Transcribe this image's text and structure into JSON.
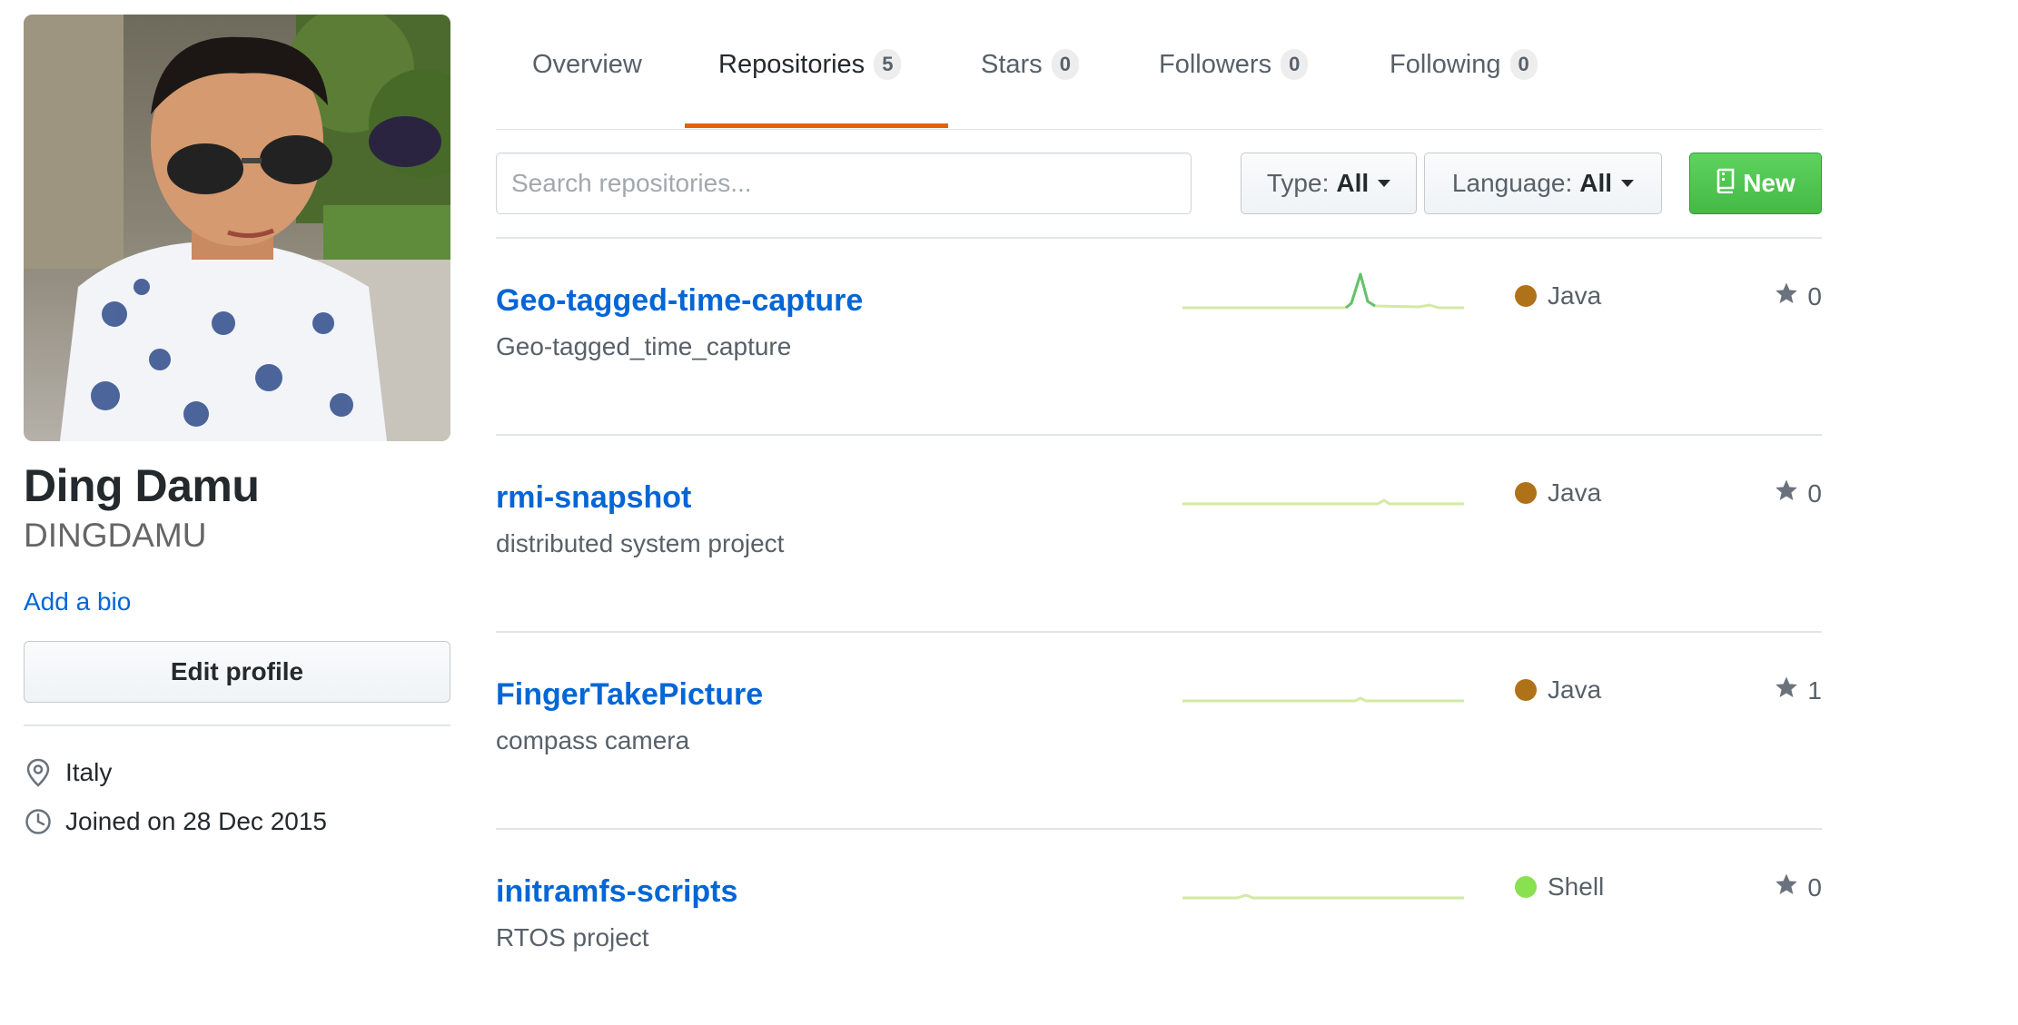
{
  "profile": {
    "full_name": "Ding Damu",
    "username": "DINGDAMU",
    "add_bio": "Add a bio",
    "edit_profile": "Edit profile",
    "location": "Italy",
    "joined": "Joined on 28 Dec 2015"
  },
  "tabs": [
    {
      "label": "Overview",
      "count": null
    },
    {
      "label": "Repositories",
      "count": "5",
      "selected": true
    },
    {
      "label": "Stars",
      "count": "0"
    },
    {
      "label": "Followers",
      "count": "0"
    },
    {
      "label": "Following",
      "count": "0"
    }
  ],
  "filters": {
    "search_placeholder": "Search repositories...",
    "type_label": "Type:",
    "type_value": "All",
    "language_label": "Language:",
    "language_value": "All",
    "new_button": "New"
  },
  "repos": [
    {
      "name": "Geo-tagged-time-capture",
      "description": "Geo-tagged_time_capture",
      "language": "Java",
      "language_color": "#b07219",
      "stars": "0"
    },
    {
      "name": "rmi-snapshot",
      "description": "distributed system project",
      "language": "Java",
      "language_color": "#b07219",
      "stars": "0"
    },
    {
      "name": "FingerTakePicture",
      "description": "compass camera",
      "language": "Java",
      "language_color": "#b07219",
      "stars": "1"
    },
    {
      "name": "initramfs-scripts",
      "description": "RTOS project",
      "language": "Shell",
      "language_color": "#89e051",
      "stars": "0"
    }
  ],
  "colors": {
    "accent_link": "#0366d6",
    "tab_underline": "#e36209",
    "new_button": "#45b845",
    "sparkline": "#d3e9a4",
    "sparkline_peak": "#63c26b"
  },
  "icons": {
    "location": "location-pin-icon",
    "joined": "clock-icon",
    "new_button": "repo-book-icon",
    "stars": "star-icon",
    "dropdown": "caret-down-icon"
  }
}
